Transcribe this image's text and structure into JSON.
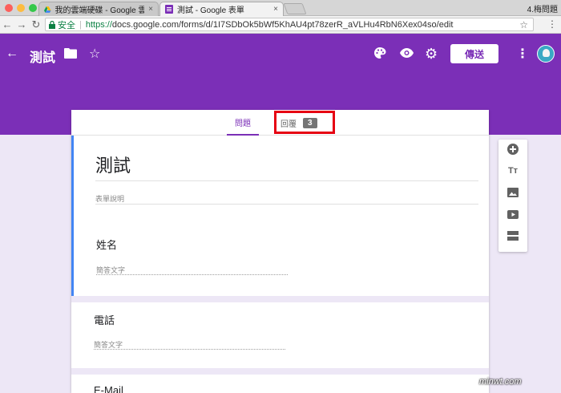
{
  "browser": {
    "tabs": [
      {
        "label": "我的雲端硬碟 - Google 雲端硬碟",
        "close": "×"
      },
      {
        "label": "測試 - Google 表單",
        "close": "×"
      }
    ],
    "user_label": "4.梅問題",
    "secure_label": "安全",
    "url_proto": "https://",
    "url_rest": "docs.google.com/forms/d/1I7SDbOk5bWf5KhAU4pt78zerR_aVLHu4RbN6Xex04so/edit"
  },
  "header": {
    "title": "測試",
    "send_label": "傳送"
  },
  "tabs": {
    "questions_label": "問題",
    "responses_label": "回覆",
    "responses_count": "3"
  },
  "form": {
    "title": "測試",
    "description_placeholder": "表單說明",
    "questions": [
      {
        "label": "姓名",
        "hint": "簡答文字"
      },
      {
        "label": "電話",
        "hint": "簡答文字"
      },
      {
        "label": "E-Mail"
      }
    ]
  },
  "watermark": "minwt.com",
  "colors": {
    "brand": "#7b2fb7",
    "background": "#ede7f6",
    "highlight": "#e60012",
    "accent_blue": "#4285f4"
  }
}
